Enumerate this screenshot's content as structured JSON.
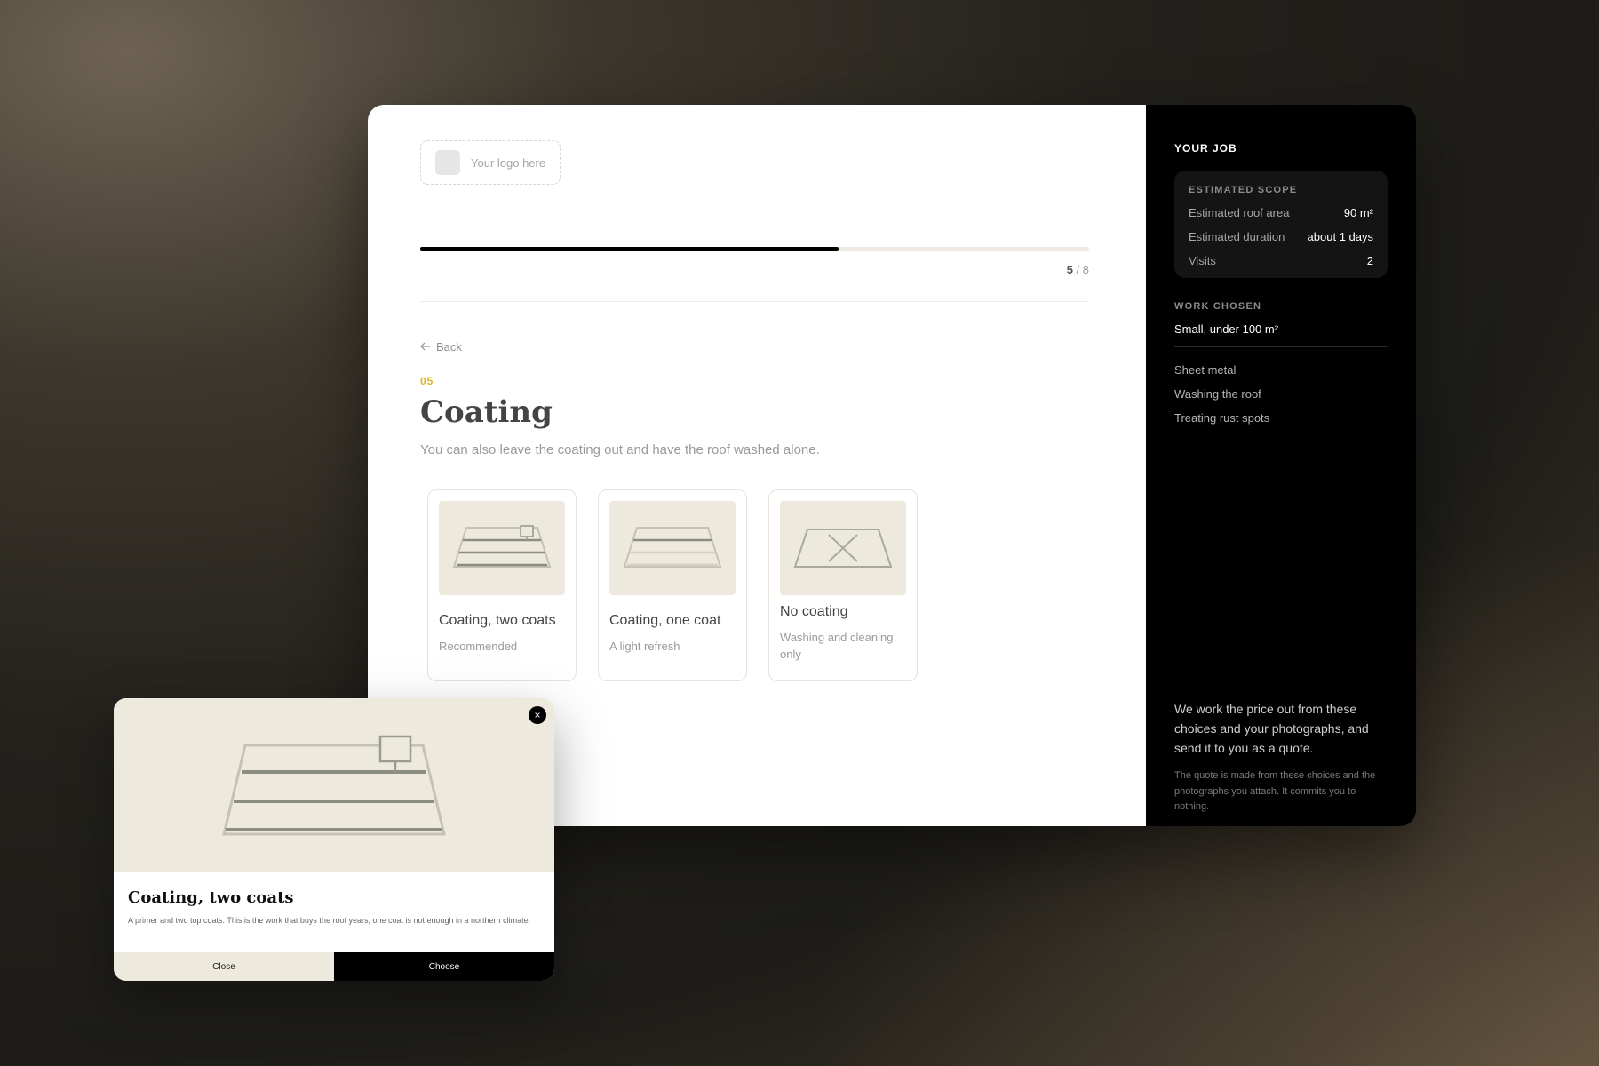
{
  "logo": {
    "placeholder": "Your logo here"
  },
  "progress": {
    "current": "5",
    "separator": " / 8",
    "fraction": 0.625
  },
  "nav": {
    "back_label": "Back"
  },
  "step": {
    "number": "05",
    "title": "Coating",
    "subtitle": "You can also leave the coating out and have the roof washed alone."
  },
  "options": [
    {
      "title": "Coating, two coats",
      "subtitle": "Recommended",
      "icon": "roof-two-coats-icon"
    },
    {
      "title": "Coating, one coat",
      "subtitle": "A light refresh",
      "icon": "roof-one-coat-icon"
    },
    {
      "title": "No coating",
      "subtitle": "Washing and cleaning only",
      "icon": "roof-no-coating-icon"
    }
  ],
  "sidebar": {
    "heading": "YOUR JOB",
    "scope": {
      "heading": "ESTIMATED SCOPE",
      "rows": [
        {
          "label": "Estimated roof area",
          "value": "90 m²"
        },
        {
          "label": "Estimated duration",
          "value": "about 1 days"
        },
        {
          "label": "Visits",
          "value": "2"
        }
      ]
    },
    "work": {
      "heading": "WORK CHOSEN",
      "main": "Small, under 100 m²",
      "items": [
        "Sheet metal",
        "Washing the roof",
        "Treating rust spots"
      ]
    },
    "footer": {
      "lead": "We work the price out from these choices and your photographs, and send it to you as a quote.",
      "small": "The quote is made from these choices and the photographs you attach. It commits you to nothing."
    }
  },
  "modal": {
    "title": "Coating, two coats",
    "text": "A primer and two top coats. This is the work that buys the roof years, one coat is not enough in a northern climate.",
    "close_label": "Close",
    "choose_label": "Choose",
    "close_icon": "×"
  },
  "colors": {
    "accent": "#d9b62c",
    "thumb_bg": "#ede9dd",
    "sidebar_bg": "#000000"
  }
}
